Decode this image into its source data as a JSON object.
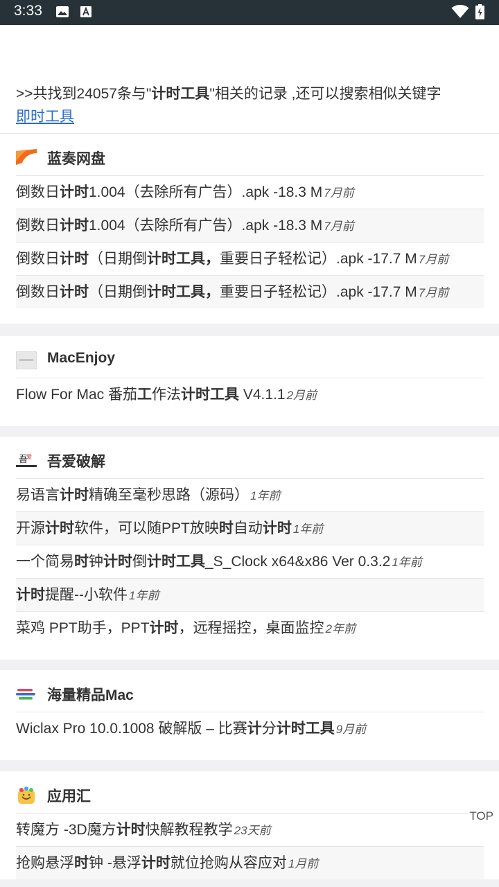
{
  "status_bar": {
    "time": "3:33"
  },
  "summary": {
    "prefix": ">>共找到24057条与\"",
    "keyword": "计时工具",
    "suffix": "\"相关的记录 ,还可以搜索相似关键字",
    "related_link": "即时工具"
  },
  "cards": [
    {
      "name": "蓝奏网盘",
      "logo_icon": "lanzou-logo-icon",
      "rows": [
        {
          "parts": [
            [
              "倒数日",
              0
            ],
            [
              "计时",
              1
            ],
            [
              "1.004（去除所有广告）.apk -18.3 M",
              0
            ]
          ],
          "time": "7月前"
        },
        {
          "parts": [
            [
              "倒数日",
              0
            ],
            [
              "计时",
              1
            ],
            [
              "1.004（去除所有广告）.apk -18.3 M",
              0
            ]
          ],
          "time": "7月前"
        },
        {
          "parts": [
            [
              "倒数日",
              0
            ],
            [
              "计时",
              1
            ],
            [
              "（日期倒",
              0
            ],
            [
              "计时工具",
              1
            ],
            [
              "，",
              1
            ],
            [
              "重要日子轻松记）.apk -17.7 M",
              0
            ]
          ],
          "time": "7月前"
        },
        {
          "parts": [
            [
              "倒数日",
              0
            ],
            [
              "计时",
              1
            ],
            [
              "（日期倒",
              0
            ],
            [
              "计时工具",
              1
            ],
            [
              "，",
              1
            ],
            [
              "重要日子轻松记）.apk -17.7 M",
              0
            ]
          ],
          "time": "7月前"
        }
      ]
    },
    {
      "name": "MacEnjoy",
      "logo_icon": "macenjoy-logo-icon",
      "rows": [
        {
          "parts": [
            [
              "Flow For Mac 番茄",
              0
            ],
            [
              "工",
              1
            ],
            [
              "作法",
              0
            ],
            [
              "计时工具",
              1
            ],
            [
              " V4.1.1",
              0
            ]
          ],
          "time": "2月前"
        }
      ]
    },
    {
      "name": "吾爱破解",
      "logo_icon": "52pojie-logo-icon",
      "rows": [
        {
          "parts": [
            [
              "易语言",
              0
            ],
            [
              "计时",
              1
            ],
            [
              "精确至毫秒思路（源码）",
              0
            ]
          ],
          "time": "1年前"
        },
        {
          "parts": [
            [
              "开源",
              0
            ],
            [
              "计时",
              1
            ],
            [
              "软件，可以随PPT放映",
              0
            ],
            [
              "时",
              1
            ],
            [
              "自动",
              0
            ],
            [
              "计时",
              1
            ]
          ],
          "time": "1年前"
        },
        {
          "parts": [
            [
              "一个简易",
              0
            ],
            [
              "时",
              1
            ],
            [
              "钟",
              0
            ],
            [
              "计时",
              1
            ],
            [
              "倒",
              0
            ],
            [
              "计时工具",
              1
            ],
            [
              "_S_Clock x64&x86 Ver 0.3.2",
              0
            ]
          ],
          "time": "1年前"
        },
        {
          "parts": [
            [
              "计时",
              1
            ],
            [
              "提醒--小软件",
              0
            ]
          ],
          "time": "1年前"
        },
        {
          "parts": [
            [
              "菜鸡 PPT助手，PPT",
              0
            ],
            [
              "计时",
              1
            ],
            [
              "，远程摇控，桌面监控",
              0
            ]
          ],
          "time": "2年前"
        }
      ]
    },
    {
      "name": "海量精品Mac",
      "logo_icon": "hailiang-logo-icon",
      "rows": [
        {
          "parts": [
            [
              "Wiclax Pro 10.0.1008 破解版 – 比赛",
              0
            ],
            [
              "计",
              1
            ],
            [
              "分",
              0
            ],
            [
              "计时工具",
              1
            ]
          ],
          "time": "9月前"
        }
      ]
    },
    {
      "name": "应用汇",
      "logo_icon": "yingyonghui-logo-icon",
      "rows": [
        {
          "parts": [
            [
              "转魔方 -3D魔方",
              0
            ],
            [
              "计时",
              1
            ],
            [
              "快解教程教学",
              0
            ]
          ],
          "time": "23天前"
        },
        {
          "parts": [
            [
              "抢购悬浮",
              0
            ],
            [
              "时",
              1
            ],
            [
              "钟 -悬浮",
              0
            ],
            [
              "计时",
              1
            ],
            [
              "就位抢购从容应对",
              0
            ]
          ],
          "time": "1月前"
        }
      ]
    }
  ],
  "top_button": "TOP"
}
